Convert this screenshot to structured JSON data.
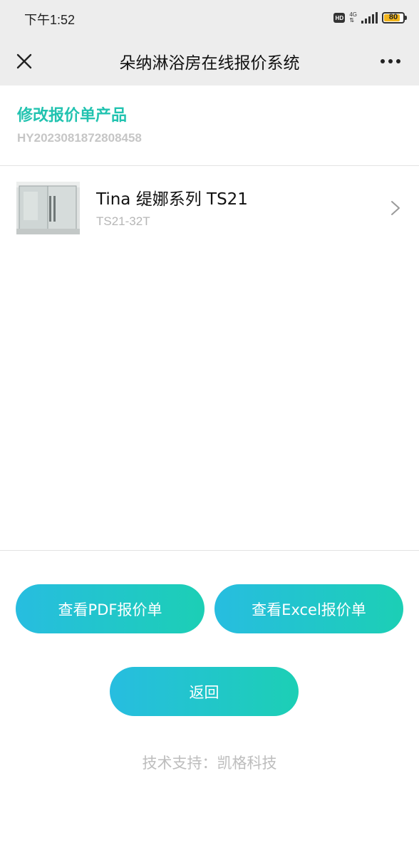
{
  "status_bar": {
    "time": "下午1:52",
    "hd_badge": "HD",
    "network": "4G",
    "battery": "80",
    "battery_level": 0.8
  },
  "nav": {
    "title": "朵纳淋浴房在线报价系统",
    "close_icon": "close-icon",
    "more_icon": "more-icon"
  },
  "header": {
    "title": "修改报价单产品",
    "order_no": "HY2023081872808458"
  },
  "products": [
    {
      "name": "Tina 缇娜系列 TS21",
      "code": "TS21-32T"
    }
  ],
  "buttons": {
    "pdf": "查看PDF报价单",
    "excel": "查看Excel报价单",
    "back": "返回"
  },
  "footer": {
    "text": "技术支持：凯格科技"
  },
  "colors": {
    "accent": "#22c3b0",
    "button_start": "#27bde0",
    "button_end": "#1ccfb5",
    "muted": "#c6c6c6"
  }
}
